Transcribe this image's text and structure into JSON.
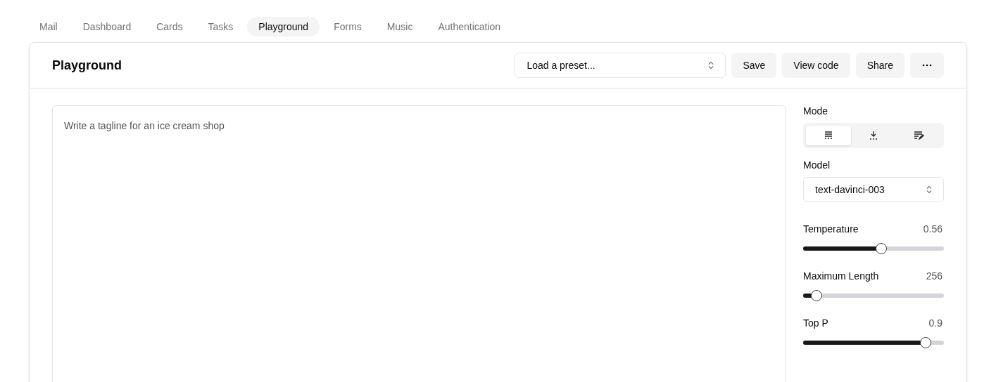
{
  "nav": [
    {
      "label": "Mail",
      "selected": false
    },
    {
      "label": "Dashboard",
      "selected": false
    },
    {
      "label": "Cards",
      "selected": false
    },
    {
      "label": "Tasks",
      "selected": false
    },
    {
      "label": "Playground",
      "selected": true
    },
    {
      "label": "Forms",
      "selected": false
    },
    {
      "label": "Music",
      "selected": false
    },
    {
      "label": "Authentication",
      "selected": false
    }
  ],
  "header": {
    "title": "Playground",
    "preset": {
      "placeholder": "Load a preset..."
    },
    "buttons": [
      {
        "kind": "text",
        "label": "Save"
      },
      {
        "kind": "text",
        "label": "View code"
      },
      {
        "kind": "text",
        "label": "Share"
      },
      {
        "kind": "more"
      }
    ]
  },
  "editor": {
    "placeholder": "Write a tagline for an ice cream shop"
  },
  "settings": {
    "mode": {
      "label": "Mode",
      "options": [
        {
          "kind": "complete",
          "selected": true
        },
        {
          "kind": "insert",
          "selected": false
        },
        {
          "kind": "edit",
          "selected": false
        }
      ]
    },
    "model": {
      "label": "Model",
      "value": "text-davinci-003"
    },
    "sliders": [
      {
        "label": "Temperature",
        "reading": "0.56",
        "level": 0.56
      },
      {
        "label": "Maximum Length",
        "reading": "256",
        "level": 0.06
      },
      {
        "label": "Top P",
        "reading": "0.9",
        "level": 0.9
      }
    ]
  }
}
